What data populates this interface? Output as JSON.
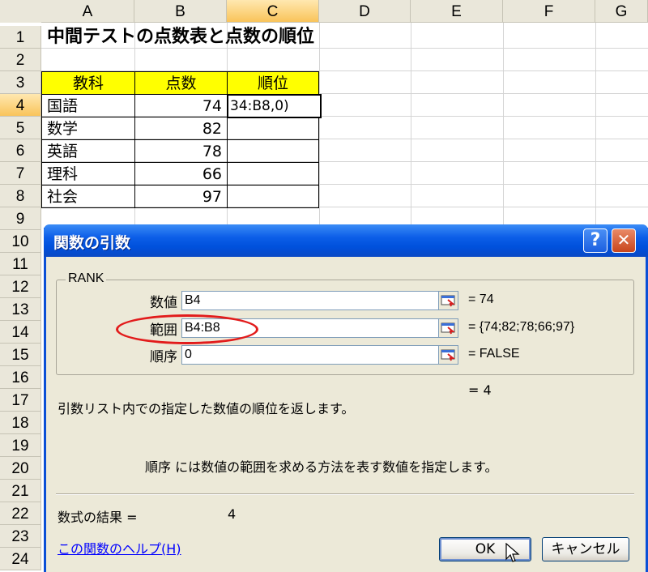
{
  "sheet": {
    "columns": [
      "A",
      "B",
      "C",
      "D",
      "E",
      "F",
      "G"
    ],
    "rows": [
      "1",
      "2",
      "3",
      "4",
      "5",
      "6",
      "7",
      "8",
      "9",
      "10",
      "11",
      "12",
      "13",
      "14",
      "15",
      "16",
      "17",
      "18",
      "19",
      "20",
      "21",
      "22",
      "23",
      "24"
    ],
    "title": "中間テストの点数表と点数の順位",
    "headers": {
      "subject": "教科",
      "score": "点数",
      "rank": "順位"
    },
    "data": [
      {
        "subject": "国語",
        "score": "74"
      },
      {
        "subject": "数学",
        "score": "82"
      },
      {
        "subject": "英語",
        "score": "78"
      },
      {
        "subject": "理科",
        "score": "66"
      },
      {
        "subject": "社会",
        "score": "97"
      }
    ],
    "active_cell_text": "34:B8,0)",
    "active_cell": "C4"
  },
  "dialog": {
    "title": "関数の引数",
    "help_button": "?",
    "close_button": "✕",
    "function_name": "RANK",
    "args": [
      {
        "label": "数値",
        "value": "B4",
        "result": "= 74"
      },
      {
        "label": "範囲",
        "value": "B4:B8",
        "result": "= {74;82;78;66;97}"
      },
      {
        "label": "順序",
        "value": "0",
        "result": "= FALSE"
      }
    ],
    "overall_result": "= 4",
    "description": "引数リスト内での指定した数値の順位を返します。",
    "arg_description": "順序 には数値の範囲を求める方法を表す数値を指定します。",
    "formula_result_label": "数式の結果 =",
    "formula_result_value": "4",
    "help_link": "この関数のヘルプ(H)",
    "ok_button": "OK",
    "cancel_button": "キャンセル"
  },
  "colors": {
    "header_fill": "#ffff00",
    "titlebar": "#0054e3",
    "highlight_oval": "#e21b1b"
  }
}
